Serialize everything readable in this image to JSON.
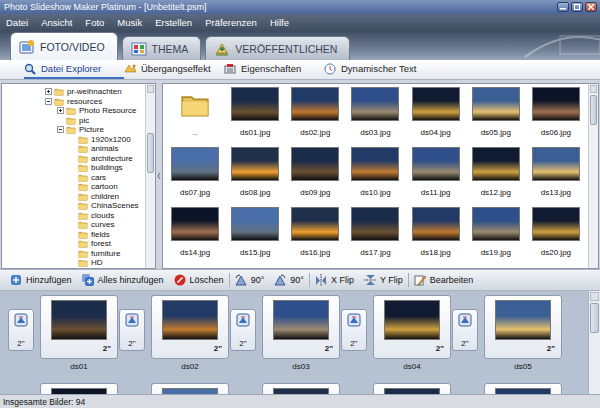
{
  "window": {
    "title": "Photo Slideshow Maker Platinum - [Unbetitelt.psm]"
  },
  "menu": [
    "Datei",
    "Ansicht",
    "Foto",
    "Musik",
    "Erstellen",
    "Präferenzen",
    "Hilfe"
  ],
  "tabs": [
    {
      "label": "FOTO/VIDEO",
      "selected": true
    },
    {
      "label": "THEMA",
      "selected": false
    },
    {
      "label": "VERÖFFENTLICHEN",
      "selected": false
    }
  ],
  "subtabs": [
    {
      "label": "Datei Explorer",
      "selected": true
    },
    {
      "label": "Übergangseffekt",
      "selected": false
    },
    {
      "label": "Eigenschaften",
      "selected": false
    },
    {
      "label": "Dynamischer Text",
      "selected": false
    }
  ],
  "tree": {
    "items": [
      {
        "label": "pr-weihnachten",
        "depth": 0,
        "kind": "collapsed"
      },
      {
        "label": "resources",
        "depth": 0,
        "kind": "expanded"
      },
      {
        "label": "Photo Resource",
        "depth": 1,
        "kind": "collapsed"
      },
      {
        "label": "pic",
        "depth": 1,
        "kind": "leaf"
      },
      {
        "label": "Picture",
        "depth": 1,
        "kind": "expanded"
      },
      {
        "label": "1920x1200",
        "depth": 2,
        "kind": "leaf"
      },
      {
        "label": "animals",
        "depth": 2,
        "kind": "leaf"
      },
      {
        "label": "architecture",
        "depth": 2,
        "kind": "leaf"
      },
      {
        "label": "buildings",
        "depth": 2,
        "kind": "leaf"
      },
      {
        "label": "cars",
        "depth": 2,
        "kind": "leaf"
      },
      {
        "label": "cartoon",
        "depth": 2,
        "kind": "leaf"
      },
      {
        "label": "children",
        "depth": 2,
        "kind": "leaf"
      },
      {
        "label": "ChinaScenes",
        "depth": 2,
        "kind": "leaf"
      },
      {
        "label": "clouds",
        "depth": 2,
        "kind": "leaf"
      },
      {
        "label": "curves",
        "depth": 2,
        "kind": "leaf"
      },
      {
        "label": "fields",
        "depth": 2,
        "kind": "leaf"
      },
      {
        "label": "forest",
        "depth": 2,
        "kind": "leaf"
      },
      {
        "label": "furniture",
        "depth": 2,
        "kind": "leaf"
      },
      {
        "label": "HD",
        "depth": 2,
        "kind": "leaf"
      }
    ]
  },
  "thumbnails": [
    {
      "label": "..",
      "kind": "folder"
    },
    {
      "label": "ds01.jpg",
      "kind": "photo"
    },
    {
      "label": "ds02.jpg",
      "kind": "photo"
    },
    {
      "label": "ds03.jpg",
      "kind": "photo"
    },
    {
      "label": "ds04.jpg",
      "kind": "photo"
    },
    {
      "label": "ds05.jpg",
      "kind": "photo"
    },
    {
      "label": "ds06.jpg",
      "kind": "photo"
    },
    {
      "label": "ds07.jpg",
      "kind": "photo"
    },
    {
      "label": "ds08.jpg",
      "kind": "photo"
    },
    {
      "label": "ds09.jpg",
      "kind": "photo"
    },
    {
      "label": "ds10.jpg",
      "kind": "photo"
    },
    {
      "label": "ds11.jpg",
      "kind": "photo"
    },
    {
      "label": "ds12.jpg",
      "kind": "photo"
    },
    {
      "label": "ds13.jpg",
      "kind": "photo"
    },
    {
      "label": "ds14.jpg",
      "kind": "photo"
    },
    {
      "label": "ds15.jpg",
      "kind": "photo"
    },
    {
      "label": "ds16.jpg",
      "kind": "photo"
    },
    {
      "label": "ds17.jpg",
      "kind": "photo"
    },
    {
      "label": "ds18.jpg",
      "kind": "photo"
    },
    {
      "label": "ds19.jpg",
      "kind": "photo"
    },
    {
      "label": "ds20.jpg",
      "kind": "photo"
    }
  ],
  "toolbar": [
    {
      "label": "Hinzufügen",
      "kind": "add"
    },
    {
      "label": "Alles hinzufügen",
      "kind": "addall"
    },
    {
      "label": "Löschen",
      "kind": "delete"
    },
    {
      "label": "90°",
      "kind": "rotleft"
    },
    {
      "label": "90°",
      "kind": "rotright"
    },
    {
      "label": "X Flip",
      "kind": "flipx"
    },
    {
      "label": "Y Flip",
      "kind": "flipy"
    },
    {
      "label": "Bearbeiten",
      "kind": "edit"
    }
  ],
  "storyboard": {
    "slides": [
      {
        "name": "ds01",
        "duration": "2\"",
        "transition": "2\""
      },
      {
        "name": "ds02",
        "duration": "2\"",
        "transition": "2\""
      },
      {
        "name": "ds03",
        "duration": "2\"",
        "transition": "2\""
      },
      {
        "name": "ds04",
        "duration": "2\"",
        "transition": "2\""
      },
      {
        "name": "ds05",
        "duration": "2\"",
        "transition": "2\""
      }
    ]
  },
  "status_bar": "Insgesamte Bilder: 94"
}
